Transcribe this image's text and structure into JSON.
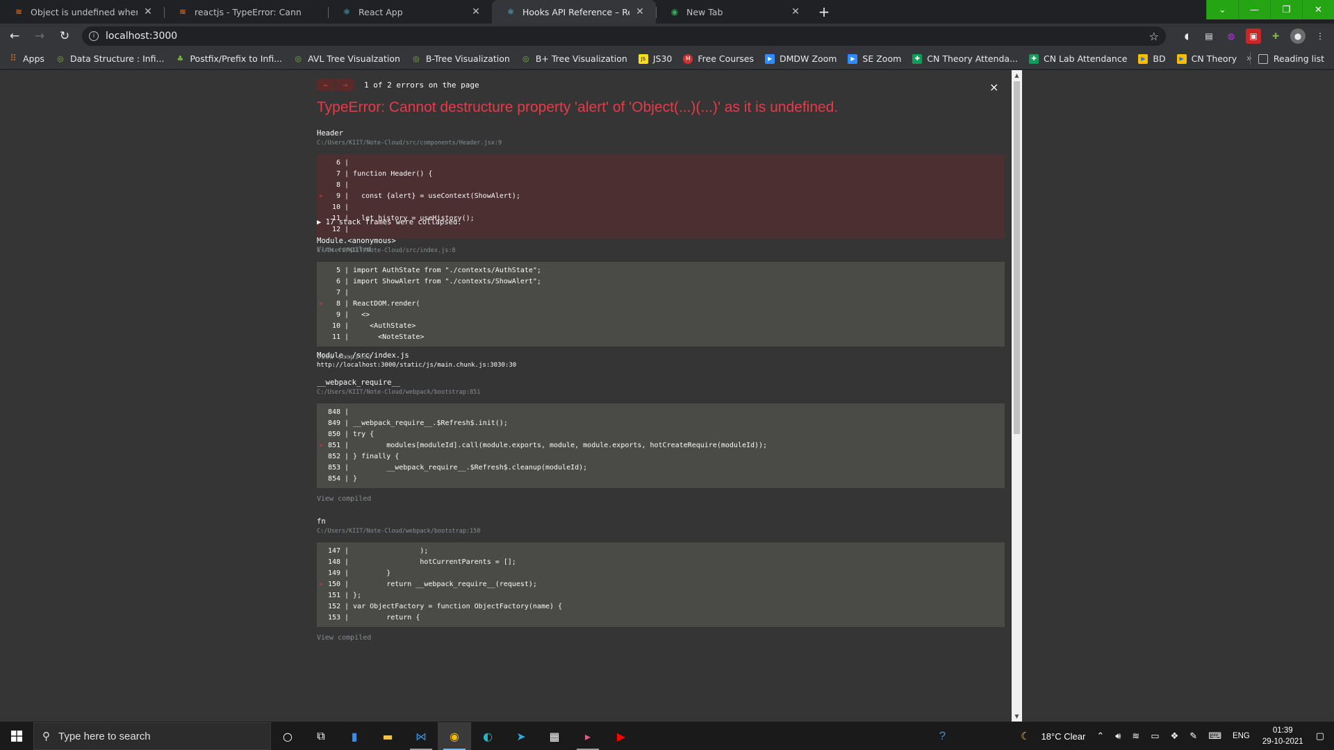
{
  "tabs": [
    {
      "title": "Object is undefined when trying",
      "icon": "stackoverflow-icon",
      "active": false
    },
    {
      "title": "reactjs - TypeError: Cannot destr",
      "icon": "stackoverflow-icon",
      "active": false
    },
    {
      "title": "React App",
      "icon": "react-icon",
      "active": false
    },
    {
      "title": "Hooks API Reference – React",
      "icon": "react-icon",
      "active": true
    },
    {
      "title": "New Tab",
      "icon": "chrome-icon",
      "active": false
    }
  ],
  "address": {
    "url": "localhost:3000"
  },
  "bookmarks": [
    {
      "label": "Apps",
      "icon": "apps-grid-icon",
      "color": "#e8710a"
    },
    {
      "label": "Data Structure : Infi...",
      "icon": "globe-icon",
      "color": "#7cb342"
    },
    {
      "label": "Postfix/Prefix to Infi...",
      "icon": "site-icon",
      "color": "#2e7d32"
    },
    {
      "label": "AVL Tree Visualzation",
      "icon": "globe-icon",
      "color": "#7cb342"
    },
    {
      "label": "B-Tree Visualization",
      "icon": "globe-icon",
      "color": "#7cb342"
    },
    {
      "label": "B+ Tree Visualization",
      "icon": "globe-icon",
      "color": "#7cb342"
    },
    {
      "label": "JS30",
      "icon": "js30-icon",
      "color": "#f7df1e"
    },
    {
      "label": "Free Courses",
      "icon": "m-icon",
      "color": "#d32f2f"
    },
    {
      "label": "DMDW Zoom",
      "icon": "zoom-icon",
      "color": "#2d8cff"
    },
    {
      "label": "SE Zoom",
      "icon": "zoom-icon",
      "color": "#2d8cff"
    },
    {
      "label": "CN Theory Attenda...",
      "icon": "sheets-icon",
      "color": "#0f9d58"
    },
    {
      "label": "CN Lab Attendance",
      "icon": "sheets-icon",
      "color": "#0f9d58"
    },
    {
      "label": "BD",
      "icon": "meet-icon",
      "color": "#fbbc04"
    },
    {
      "label": "CN Theory",
      "icon": "meet-icon",
      "color": "#fbbc04"
    }
  ],
  "bookmarks_more": "»",
  "reading_list": "Reading list",
  "overlay": {
    "nav_prev": "←",
    "nav_next": "→",
    "error_count": "1 of 2 errors on the page",
    "close": "×",
    "title": "TypeError: Cannot destructure property 'alert' of 'Object(...)(...)' as it is undefined.",
    "frames": [
      {
        "name": "Header",
        "path": "C:/Users/KIIT/Note-Cloud/src/components/Header.jsx:9",
        "kind": "err",
        "lines": [
          {
            "no": "6",
            "src": "",
            "mark": false
          },
          {
            "no": "7",
            "src": "function Header() {",
            "mark": false
          },
          {
            "no": "8",
            "src": "",
            "mark": false
          },
          {
            "no": "9",
            "src": "  const {alert} = useContext(ShowAlert);",
            "mark": true
          },
          {
            "no": "10",
            "src": "",
            "mark": false
          },
          {
            "no": "11",
            "src": "  let history = useHistory();",
            "mark": false
          },
          {
            "no": "12",
            "src": "",
            "mark": false
          }
        ],
        "compiled": "View compiled"
      },
      {
        "name": "Module.<anonymous>",
        "path": "C:/Users/KIIT/Note-Cloud/src/index.js:8",
        "kind": "neu",
        "lines": [
          {
            "no": "5",
            "src": "import AuthState from \"./contexts/AuthState\";",
            "mark": false
          },
          {
            "no": "6",
            "src": "import ShowAlert from \"./contexts/ShowAlert\";",
            "mark": false
          },
          {
            "no": "7",
            "src": "",
            "mark": false
          },
          {
            "no": "8",
            "src": "ReactDOM.render(",
            "mark": true
          },
          {
            "no": "9",
            "src": "  <>",
            "mark": false
          },
          {
            "no": "10",
            "src": "    <AuthState>",
            "mark": false
          },
          {
            "no": "11",
            "src": "      <NoteState>",
            "mark": false
          }
        ],
        "compiled": "View compiled"
      },
      {
        "name": "__webpack_require__",
        "path": "C:/Users/KIIT/Note-Cloud/webpack/bootstrap:851",
        "kind": "neu",
        "lines": [
          {
            "no": "848",
            "src": "",
            "mark": false
          },
          {
            "no": "849",
            "src": "__webpack_require__.$Refresh$.init();",
            "mark": false
          },
          {
            "no": "850",
            "src": "try {",
            "mark": false
          },
          {
            "no": "851",
            "src": "        modules[moduleId].call(module.exports, module, module.exports, hotCreateRequire(moduleId));",
            "mark": true
          },
          {
            "no": "852",
            "src": "} finally {",
            "mark": false
          },
          {
            "no": "853",
            "src": "        __webpack_require__.$Refresh$.cleanup(moduleId);",
            "mark": false
          },
          {
            "no": "854",
            "src": "}",
            "mark": false
          }
        ],
        "compiled": "View compiled"
      },
      {
        "name": "fn",
        "path": "C:/Users/KIIT/Note-Cloud/webpack/bootstrap:150",
        "kind": "neu",
        "lines": [
          {
            "no": "147",
            "src": "                );",
            "mark": false
          },
          {
            "no": "148",
            "src": "                hotCurrentParents = [];",
            "mark": false
          },
          {
            "no": "149",
            "src": "        }",
            "mark": false
          },
          {
            "no": "150",
            "src": "        return __webpack_require__(request);",
            "mark": true
          },
          {
            "no": "151",
            "src": "};",
            "mark": false
          },
          {
            "no": "152",
            "src": "var ObjectFactory = function ObjectFactory(name) {",
            "mark": false
          },
          {
            "no": "153",
            "src": "        return {",
            "mark": false
          }
        ],
        "compiled": "View compiled"
      }
    ],
    "collapsed": "▶ 17 stack frames were collapsed.",
    "plain_frame": {
      "name": "Module../src/index.js",
      "path": "http://localhost:3000/static/js/main.chunk.js:3030:30"
    }
  },
  "taskbar": {
    "search_placeholder": "Type here to search",
    "weather": "18°C  Clear",
    "lang": "ENG",
    "time": "01:39",
    "date": "29-10-2021"
  }
}
